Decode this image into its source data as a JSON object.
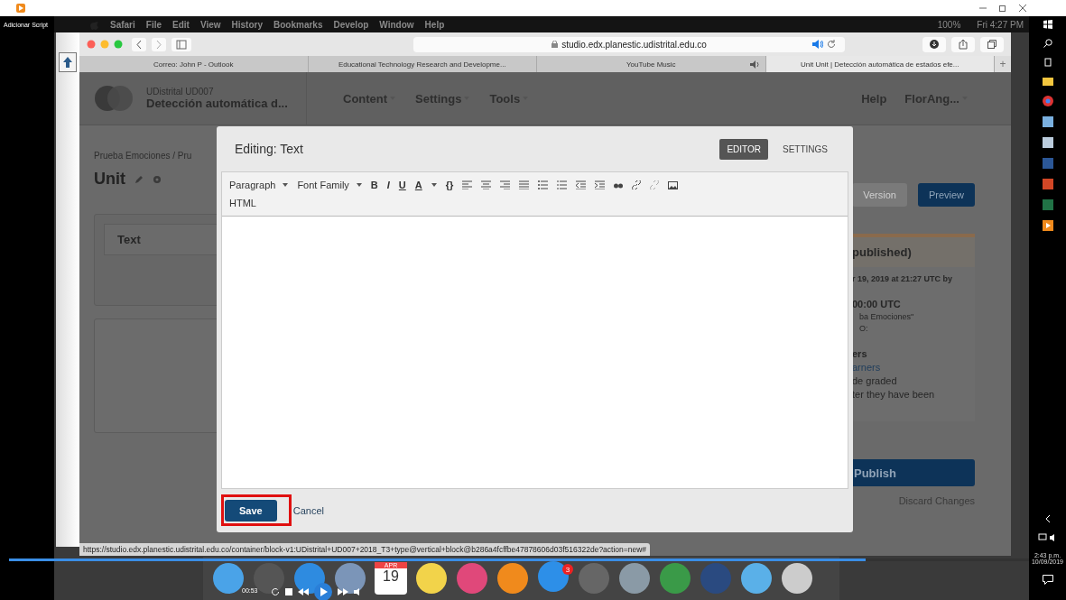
{
  "host_window": {
    "side_label": "Adicionar Script"
  },
  "mac_menu_bar": {
    "menus": [
      "Safari",
      "File",
      "Edit",
      "View",
      "History",
      "Bookmarks",
      "Develop",
      "Window",
      "Help"
    ],
    "battery": "100%",
    "clock": "Fri 4:27 PM"
  },
  "safari": {
    "url": "studio.edx.planestic.udistrital.edu.co",
    "tabs": [
      {
        "title": "Correo: John P - Outlook",
        "selected": false,
        "audio": false
      },
      {
        "title": "Educational Technology Research and Developme...",
        "selected": false,
        "audio": false
      },
      {
        "title": "YouTube Music",
        "selected": false,
        "audio": true
      },
      {
        "title": "Unit Unit | Detección automática de estados efe...",
        "selected": true,
        "audio": false
      }
    ],
    "new_tab": "+",
    "status_url": "https://studio.edx.planestic.udistrital.edu.co/container/block-v1:UDistrital+UD007+2018_T3+type@vertical+block@b286a4fcffbe47878606d03f516322de?action=new#"
  },
  "studio": {
    "org": "UDistrital UD007",
    "course": "Detección automática d...",
    "nav": [
      "Content",
      "Settings",
      "Tools"
    ],
    "help": "Help",
    "user": "FlorAng...",
    "breadcrumb": "Prueba Emociones / Pru",
    "unit_title": "Unit",
    "component_title": "Text",
    "sidebar_buttons": [
      {
        "label": "Version",
        "disabled": true
      },
      {
        "label": "Preview",
        "disabled": false
      }
    ],
    "status_title": "published)",
    "status_lines": [
      {
        "text": "r 19, 2019 at 21:27 UTC by",
        "kind": "bold"
      },
      {
        "text": "00:00 UTC",
        "kind": "heading"
      },
      {
        "text": "ba Emociones\"",
        "kind": "small"
      },
      {
        "text": "O:",
        "kind": "small"
      },
      {
        "text": "ers",
        "kind": "heading"
      },
      {
        "text": "arners",
        "kind": "link"
      },
      {
        "text": "de graded",
        "kind": "body"
      },
      {
        "text": "ter they have been",
        "kind": "body"
      }
    ],
    "publish": "Publish",
    "discard": "Discard Changes"
  },
  "modal": {
    "title": "Editing: Text",
    "modes": [
      {
        "label": "EDITOR",
        "selected": true
      },
      {
        "label": "SETTINGS",
        "selected": false
      }
    ],
    "format": "Paragraph",
    "font": "Font Family",
    "style_buttons": [
      "B",
      "I",
      "U",
      "A"
    ],
    "code_button": "{}",
    "second_row": "HTML",
    "save": "Save",
    "cancel": "Cancel"
  },
  "dock": {
    "calendar_month": "APR",
    "calendar_day": "19",
    "app_store_badge": "3"
  },
  "video_player": {
    "time": "00:53",
    "level": 0.84
  },
  "windows_taskbar": {
    "time": "2:43 p.m.",
    "date": "10/09/2019"
  }
}
